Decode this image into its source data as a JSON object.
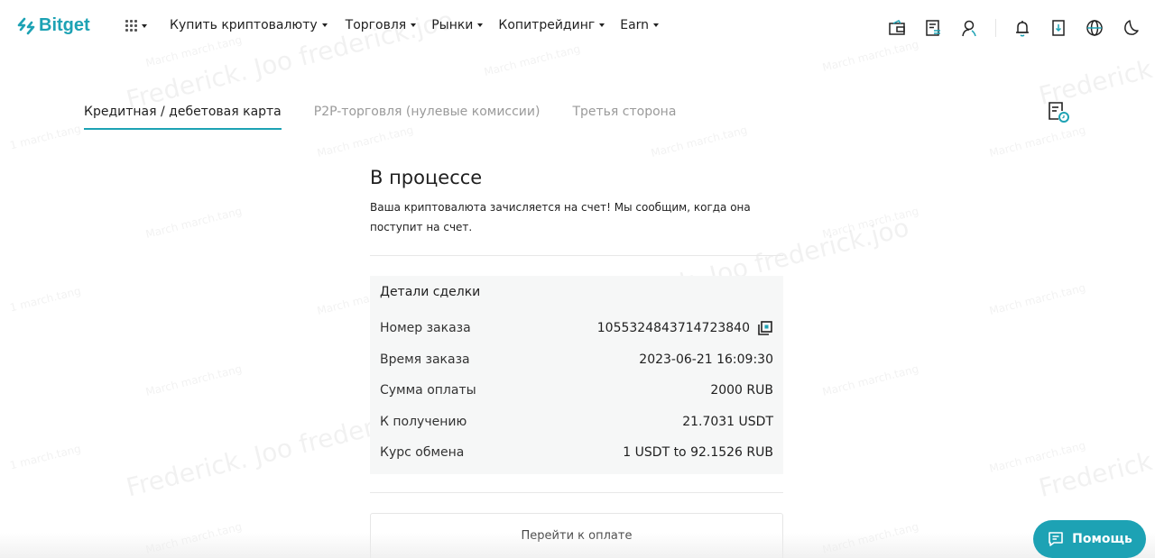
{
  "brand": {
    "name": "Bitget",
    "accent": "#1da2b4"
  },
  "nav": {
    "items": [
      {
        "label": "Купить криптовалюту"
      },
      {
        "label": "Торговля"
      },
      {
        "label": "Рынки"
      },
      {
        "label": "Копитрейдинг"
      },
      {
        "label": "Earn"
      }
    ],
    "right_icons": [
      "wallet-icon",
      "orders-icon",
      "user-icon",
      "bell-icon",
      "download-icon",
      "globe-icon",
      "moon-icon"
    ]
  },
  "tabs": [
    {
      "label": "Кредитная / дебетовая карта",
      "active": true
    },
    {
      "label": "P2P-торговля (нулевые комиссии)",
      "active": false
    },
    {
      "label": "Третья сторона",
      "active": false
    }
  ],
  "status": {
    "title": "В процессе",
    "message": "Ваша криптовалюта зачисляется на счет! Мы сообщим, когда она поступит на счет."
  },
  "details": {
    "title": "Детали сделки",
    "rows": [
      {
        "label": "Номер заказа",
        "value": "1055324843714723840"
      },
      {
        "label": "Время заказа",
        "value": "2023-06-21 16:09:30"
      },
      {
        "label": "Сумма оплаты",
        "value": "2000 RUB"
      },
      {
        "label": "К получению",
        "value": "21.7031 USDT"
      },
      {
        "label": "Курс обмена",
        "value": "1 USDT to 92.1526 RUB"
      }
    ]
  },
  "actions": {
    "pay_label": "Перейти к оплате"
  },
  "help": {
    "label": "Помощь"
  },
  "watermark": {
    "big": "Frederick. Joo frederick.joo",
    "small": "March march.tang",
    "tiny": "1 march.tang"
  }
}
